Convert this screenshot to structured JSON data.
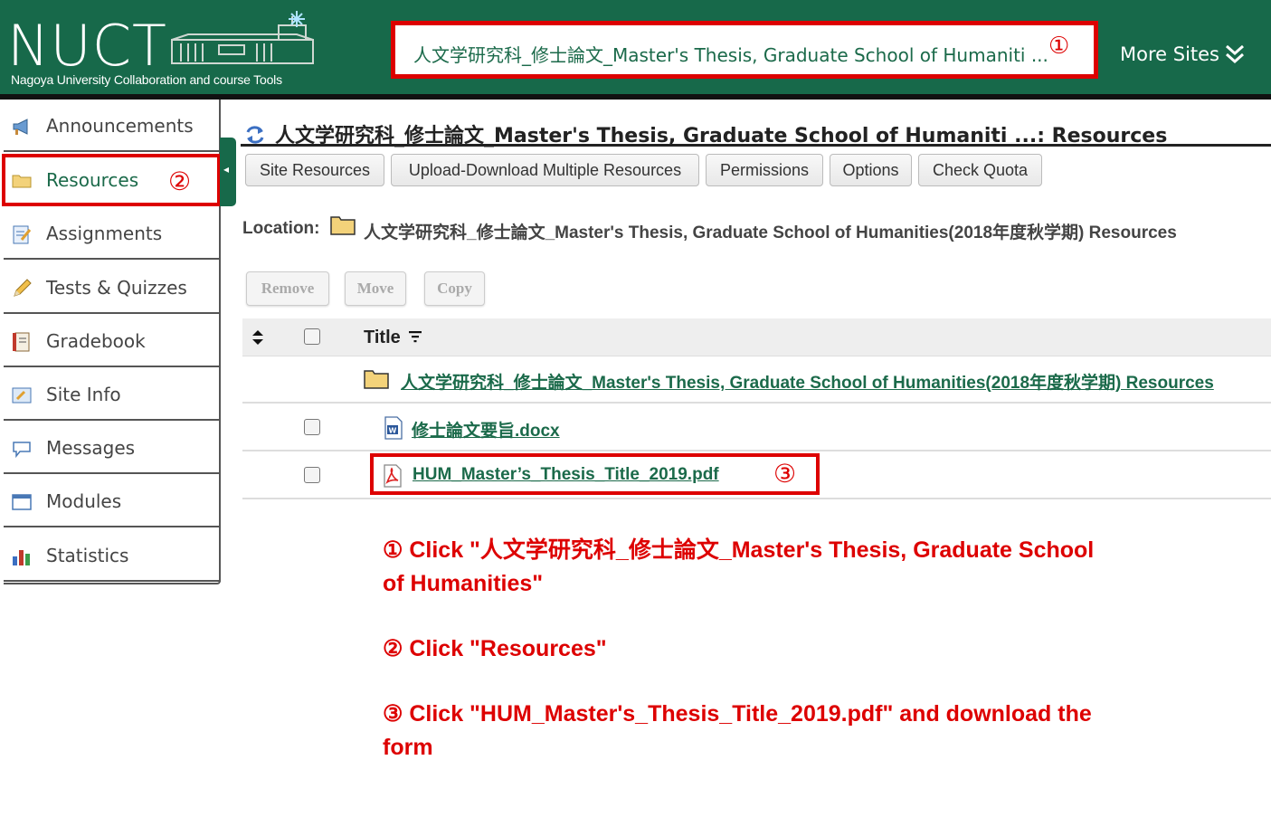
{
  "header": {
    "logo_text": "NUCT",
    "logo_subtitle": "Nagoya University Collaboration and course Tools",
    "current_site": "人文学研究科_修士論文_Master's Thesis, Graduate School of Humaniti ...",
    "site_marker": "①",
    "more_sites_label": "More Sites",
    "more_sites_icon": "double-chevron-down-icon",
    "brand_color": "#17694a",
    "highlight_color": "#dd0000"
  },
  "sidebar": {
    "items": [
      {
        "label": "Announcements",
        "icon": "megaphone-icon"
      },
      {
        "label": "Resources",
        "icon": "folder-icon",
        "active": true,
        "marker": "②"
      },
      {
        "label": "Assignments",
        "icon": "pencil-paper-icon"
      },
      {
        "label": "Tests & Quizzes",
        "icon": "pencil-icon"
      },
      {
        "label": "Gradebook",
        "icon": "gradebook-icon"
      },
      {
        "label": "Site Info",
        "icon": "site-info-icon"
      },
      {
        "label": "Messages",
        "icon": "speech-bubble-icon"
      },
      {
        "label": "Modules",
        "icon": "window-icon"
      },
      {
        "label": "Statistics",
        "icon": "bar-chart-icon"
      }
    ],
    "collapse_icon": "◂"
  },
  "main": {
    "page_title": "人文学研究科_修士論文_Master's Thesis, Graduate School of Humaniti ...: Resources",
    "toolbar": [
      "Site Resources",
      "Upload-Download Multiple Resources",
      "Permissions",
      "Options",
      "Check Quota"
    ],
    "location_label": "Location:",
    "location_path": "人文学研究科_修士論文_Master's Thesis, Graduate School of Humanities(2018年度秋学期) Resources",
    "actions": [
      "Remove",
      "Move",
      "Copy"
    ],
    "table_header_title": "Title",
    "folder_row": "人文学研究科_修士論文_Master's Thesis, Graduate School of Humanities(2018年度秋学期) Resources",
    "files": [
      {
        "name": "修士論文要旨.docx",
        "type": "word"
      },
      {
        "name": "HUM_Master’s_Thesis_Title_2019.pdf",
        "type": "pdf",
        "marker": "③"
      }
    ]
  },
  "instructions": [
    "① Click \"人文学研究科_修士論文_Master's Thesis, Graduate School of Humanities\"",
    "② Click \"Resources\"",
    "③ Click \"HUM_Master's_Thesis_Title_2019.pdf\" and download the form"
  ]
}
